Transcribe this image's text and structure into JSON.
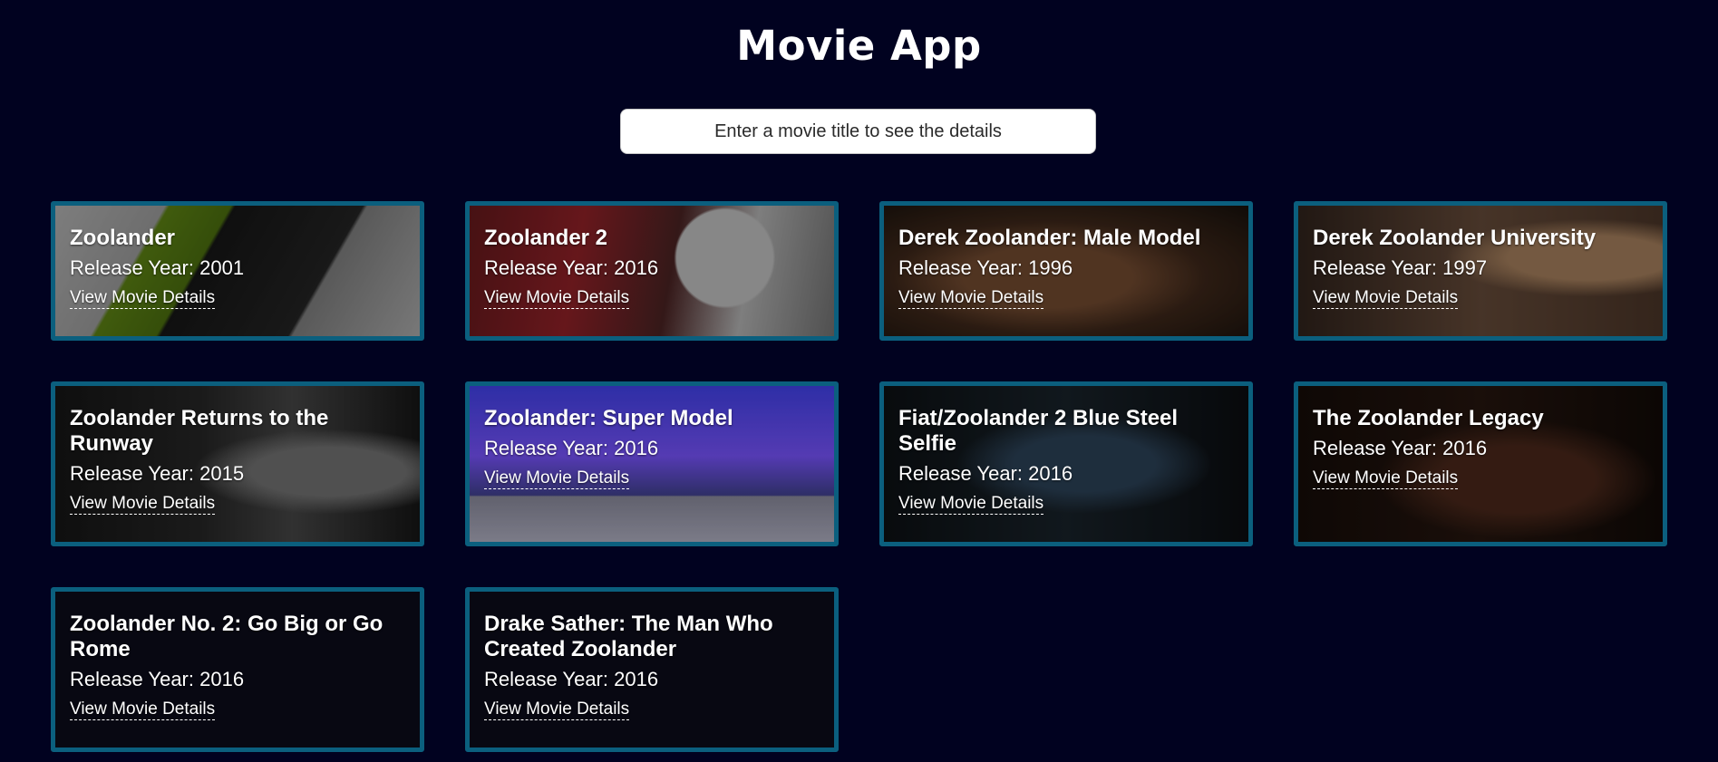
{
  "app": {
    "title": "Movie App"
  },
  "search": {
    "placeholder": "Enter a movie title to see the details"
  },
  "movies": [
    {
      "title": "Zoolander",
      "year_text": "Release Year: 2001",
      "link_text": "View Movie Details"
    },
    {
      "title": "Zoolander 2",
      "year_text": "Release Year: 2016",
      "link_text": "View Movie Details"
    },
    {
      "title": "Derek Zoolander: Male Model",
      "year_text": "Release Year: 1996",
      "link_text": "View Movie Details"
    },
    {
      "title": "Derek Zoolander University",
      "year_text": "Release Year: 1997",
      "link_text": "View Movie Details"
    },
    {
      "title": "Zoolander Returns to the Runway",
      "year_text": "Release Year: 2015",
      "link_text": "View Movie Details"
    },
    {
      "title": "Zoolander: Super Model",
      "year_text": "Release Year: 2016",
      "link_text": "View Movie Details"
    },
    {
      "title": "Fiat/Zoolander 2 Blue Steel Selfie",
      "year_text": "Release Year: 2016",
      "link_text": "View Movie Details"
    },
    {
      "title": "The Zoolander Legacy",
      "year_text": "Release Year: 2016",
      "link_text": "View Movie Details"
    },
    {
      "title": "Zoolander No. 2: Go Big or Go Rome",
      "year_text": "Release Year: 2016",
      "link_text": "View Movie Details"
    },
    {
      "title": "Drake Sather: The Man Who Created Zoolander",
      "year_text": "Release Year: 2016",
      "link_text": "View Movie Details"
    }
  ],
  "colors": {
    "background": "#010220",
    "card_border": "#0b5f7e",
    "text": "#ffffff"
  }
}
